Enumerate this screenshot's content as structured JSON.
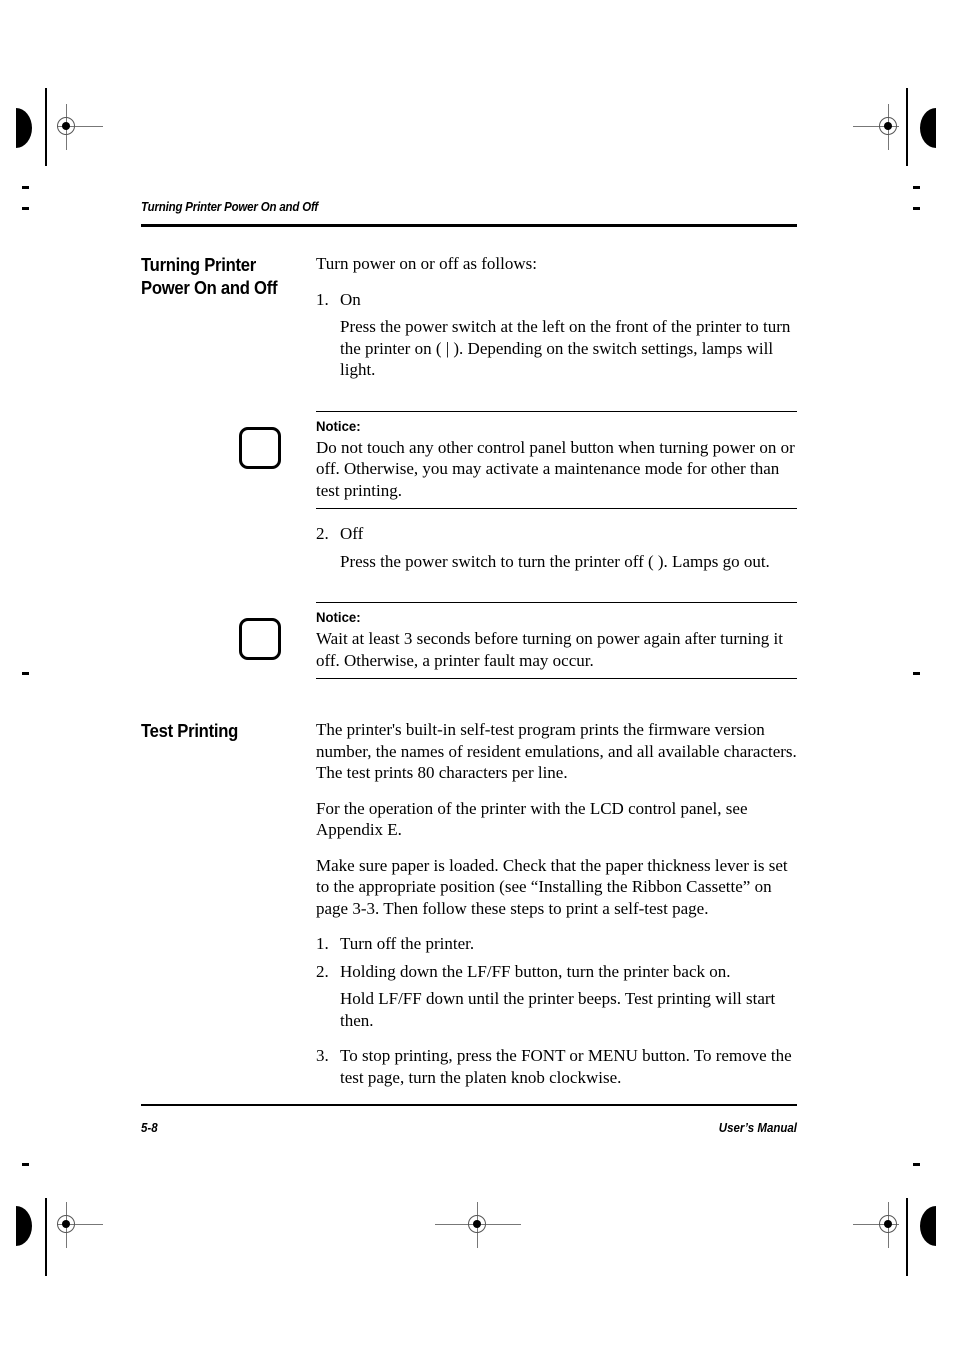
{
  "running_head": "Turning Printer Power On and Off",
  "sections": [
    {
      "title": "Turning Printer Power On and Off",
      "intro": "Turn power on or off as follows:",
      "step1_num": "1.",
      "step1_label": "On",
      "step1_text": "Press the power switch at the left on the front of the printer to turn the printer on ( | ). Depending on the switch settings, lamps will light.",
      "notice1_label": "Notice:",
      "notice1_text": "Do not touch any other control panel button when turning power on or off. Otherwise, you may activate a maintenance mode for other than test printing.",
      "step2_num": "2.",
      "step2_label": "Off",
      "step2_text": "Press the power switch to turn the printer off (    ). Lamps go out.",
      "notice2_label": "Notice:",
      "notice2_text": "Wait at least 3 seconds before turning on power again after turning it off. Otherwise, a printer fault may occur."
    },
    {
      "title": "Test Printing",
      "para1": "The printer's built-in self-test program prints the firmware version number, the names of resident emulations, and all available characters. The test prints 80 characters per line.",
      "para2": "For the operation of the printer with the LCD control panel, see Appendix E.",
      "para3": "Make sure paper is loaded. Check that the paper thickness lever is set to the appropriate position (see “Installing the Ribbon Cassette” on page 3-3. Then follow these steps to print a self-test page.",
      "steps": [
        {
          "num": "1.",
          "text": "Turn off the printer."
        },
        {
          "num": "2.",
          "text": "Holding down the LF/FF button, turn the printer back on."
        }
      ],
      "step2_sub": "Hold LF/FF down until the printer beeps. Test printing will start then.",
      "step3_num": "3.",
      "step3_text": "To stop printing, press the FONT or MENU button. To remove the test page, turn the platen knob clockwise."
    }
  ],
  "footer": {
    "page_number": "5-8",
    "manual_label": "User’s Manual"
  },
  "marks": {
    "registration_target": "registration-target-icon",
    "crop_rule": "crop-rule-mark",
    "half_moon": "half-moon-density-mark",
    "tick": "margin-tick-mark"
  }
}
